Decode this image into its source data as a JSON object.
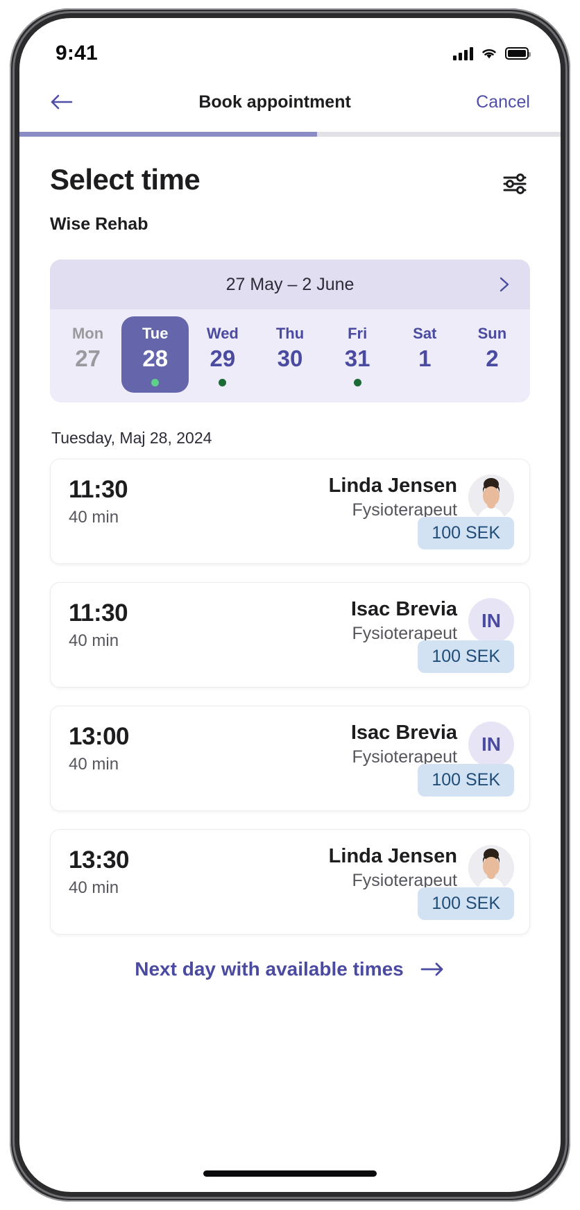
{
  "status_bar": {
    "time": "9:41",
    "cellular_icon": "signal-bars-icon",
    "wifi_icon": "wifi-icon",
    "battery_icon": "battery-full-icon"
  },
  "nav": {
    "back_icon": "back-arrow-icon",
    "title": "Book appointment",
    "cancel_label": "Cancel"
  },
  "progress": {
    "percent": 55,
    "fill_color": "#8b8bc4",
    "track_color": "#e0e0e6"
  },
  "page": {
    "title": "Select time",
    "subtitle": "Wise Rehab",
    "filter_icon": "sliders-filter-icon"
  },
  "week_picker": {
    "range_label": "27 May – 2 June",
    "next_week_icon": "chevron-right-icon",
    "selected_color": "#6465ab",
    "available_dot_color": "#1a6b36",
    "selected_dot_color": "#5fd08a",
    "days": [
      {
        "name": "Mon",
        "num": "27",
        "state": "disabled",
        "has_dot": false
      },
      {
        "name": "Tue",
        "num": "28",
        "state": "selected",
        "has_dot": true
      },
      {
        "name": "Wed",
        "num": "29",
        "state": "available",
        "has_dot": true
      },
      {
        "name": "Thu",
        "num": "30",
        "state": "available",
        "has_dot": false
      },
      {
        "name": "Fri",
        "num": "31",
        "state": "available",
        "has_dot": true
      },
      {
        "name": "Sat",
        "num": "1",
        "state": "available",
        "has_dot": false
      },
      {
        "name": "Sun",
        "num": "2",
        "state": "available",
        "has_dot": false
      }
    ]
  },
  "slots": {
    "date_label": "Tuesday, Maj 28, 2024",
    "items": [
      {
        "time": "11:30",
        "duration": "40 min",
        "staff_name": "Linda Jensen",
        "staff_role": "Fysioterapeut",
        "avatar_type": "photo",
        "avatar_initials": "",
        "price": "100 SEK"
      },
      {
        "time": "11:30",
        "duration": "40 min",
        "staff_name": "Isac Brevia",
        "staff_role": "Fysioterapeut",
        "avatar_type": "initials",
        "avatar_initials": "IN",
        "price": "100 SEK"
      },
      {
        "time": "13:00",
        "duration": "40 min",
        "staff_name": "Isac Brevia",
        "staff_role": "Fysioterapeut",
        "avatar_type": "initials",
        "avatar_initials": "IN",
        "price": "100 SEK"
      },
      {
        "time": "13:30",
        "duration": "40 min",
        "staff_name": "Linda Jensen",
        "staff_role": "Fysioterapeut",
        "avatar_type": "photo",
        "avatar_initials": "",
        "price": "100 SEK"
      }
    ]
  },
  "footer": {
    "next_day_label": "Next day with available times",
    "next_day_icon": "arrow-right-icon"
  }
}
